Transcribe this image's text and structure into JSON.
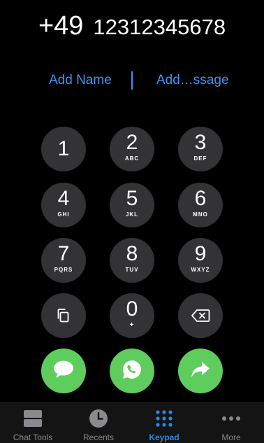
{
  "display": {
    "country_code": "+49",
    "phone_number": "12312345678"
  },
  "actions": {
    "add_name": "Add Name",
    "add_message": "Add…ssage"
  },
  "keypad": {
    "keys": [
      {
        "digit": "1",
        "letters": ""
      },
      {
        "digit": "2",
        "letters": "ABC"
      },
      {
        "digit": "3",
        "letters": "DEF"
      },
      {
        "digit": "4",
        "letters": "GHI"
      },
      {
        "digit": "5",
        "letters": "JKL"
      },
      {
        "digit": "6",
        "letters": "MNO"
      },
      {
        "digit": "7",
        "letters": "PQRS"
      },
      {
        "digit": "8",
        "letters": "TUV"
      },
      {
        "digit": "9",
        "letters": "WXYZ"
      },
      {
        "digit": "0",
        "letters": "+"
      }
    ],
    "paste_icon": "copy-paste-icon",
    "delete_icon": "backspace-icon"
  },
  "call_buttons": {
    "message_icon": "chat-bubble-icon",
    "whatsapp_icon": "whatsapp-call-icon",
    "forward_icon": "share-arrow-icon"
  },
  "tabbar": {
    "tabs": [
      {
        "label": "Chat Tools",
        "icon": "chat-tools-icon"
      },
      {
        "label": "Recents",
        "icon": "clock-icon"
      },
      {
        "label": "Keypad",
        "icon": "keypad-icon"
      },
      {
        "label": "More",
        "icon": "more-dots-icon"
      }
    ],
    "active": "Keypad"
  },
  "colors": {
    "background": "#000000",
    "key_background": "#333335",
    "accent_blue": "#3e95f2",
    "call_green": "#5fcc5e",
    "tab_active": "#2b86e9",
    "tab_inactive": "#8a8a8e"
  }
}
